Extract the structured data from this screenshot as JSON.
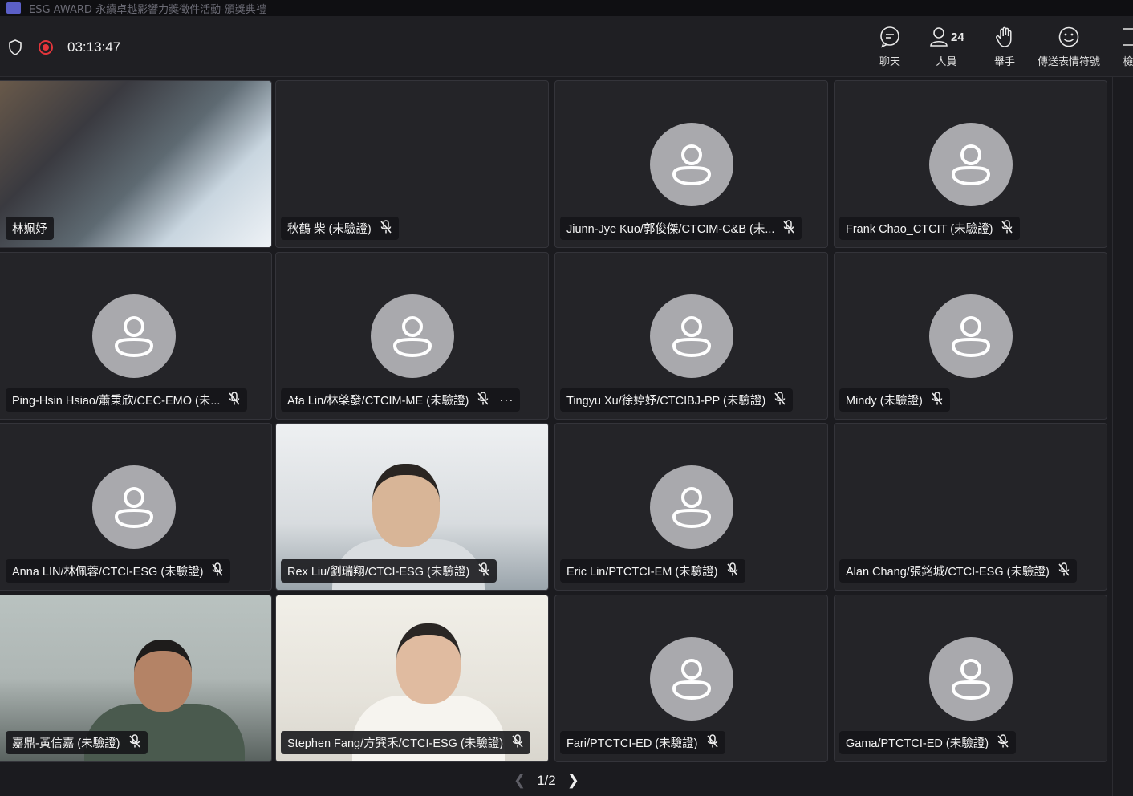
{
  "window": {
    "title": "ESG AWARD 永續卓越影響力獎徵件活動-頒獎典禮"
  },
  "toolbar": {
    "timer": "03:13:47",
    "chat_label": "聊天",
    "people_label": "人員",
    "people_count": "24",
    "raise_hand_label": "舉手",
    "reactions_label": "傳送表情符號",
    "more_label": "檢"
  },
  "tiles": [
    {
      "name": "林姵妤",
      "muted": false,
      "video": true
    },
    {
      "name": "秋鶴 柴 (未驗證)",
      "muted": true,
      "video": false,
      "avatar": false
    },
    {
      "name": "Jiunn-Jye Kuo/郭俊傑/CTCIM-C&B (未...",
      "muted": true,
      "video": false
    },
    {
      "name": "Frank Chao_CTCIT (未驗證)",
      "muted": true,
      "video": false
    },
    {
      "name": "Ping-Hsin Hsiao/蕭秉欣/CEC-EMO (未...",
      "muted": true,
      "video": false
    },
    {
      "name": "Afa Lin/林棨發/CTCIM-ME (未驗證)",
      "muted": true,
      "video": false,
      "more": "···"
    },
    {
      "name": "Tingyu Xu/徐婷妤/CTCIBJ-PP (未驗證)",
      "muted": true,
      "video": false
    },
    {
      "name": "Mindy (未驗證)",
      "muted": true,
      "video": false
    },
    {
      "name": "Anna LIN/林佩蓉/CTCI-ESG (未驗證)",
      "muted": true,
      "video": false
    },
    {
      "name": "Rex Liu/劉瑞翔/CTCI-ESG (未驗證)",
      "muted": true,
      "video": true
    },
    {
      "name": "Eric Lin/PTCTCI-EM (未驗證)",
      "muted": true,
      "video": false
    },
    {
      "name": "Alan Chang/張銘城/CTCI-ESG (未驗證)",
      "muted": true,
      "video": false,
      "avatar": false
    },
    {
      "name": "嘉鼎-黃信嘉 (未驗證)",
      "muted": true,
      "video": true
    },
    {
      "name": "Stephen Fang/方巽禾/CTCI-ESG (未驗證)",
      "muted": true,
      "video": true
    },
    {
      "name": "Fari/PTCTCI-ED (未驗證)",
      "muted": true,
      "video": false
    },
    {
      "name": "Gama/PTCTCI-ED (未驗證)",
      "muted": true,
      "video": false
    }
  ],
  "pager": {
    "label": "1/2"
  },
  "icons": {
    "prev": "chevron-left-icon",
    "next": "chevron-right-icon",
    "mic_off": "mic-off-icon"
  },
  "colors": {
    "accent": "#7f85f5",
    "record": "#e3353b",
    "background": "#1b1b1f"
  }
}
